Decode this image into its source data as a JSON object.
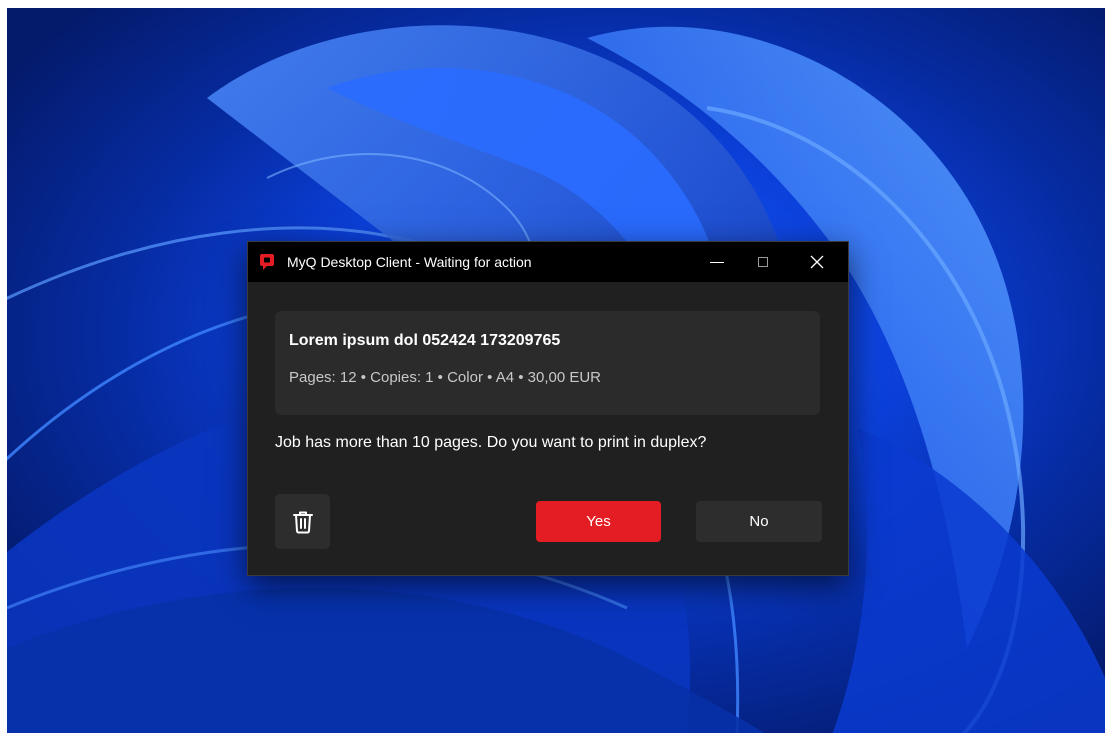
{
  "window": {
    "title": "MyQ Desktop Client - Waiting for action"
  },
  "job": {
    "name": "Lorem ipsum dol 052424 173209765",
    "details": "Pages: 12 • Copies: 1 • Color • A4 • 30,00 EUR"
  },
  "prompt": "Job has more than 10 pages. Do you want to print in duplex?",
  "buttons": {
    "yes": "Yes",
    "no": "No"
  },
  "icons": {
    "app": "myq-logo-icon",
    "delete": "trash-icon",
    "minimize": "minimize-icon",
    "maximize": "maximize-icon",
    "close": "close-icon"
  },
  "colors": {
    "accent": "#e31d23",
    "dialog_bg": "#202020",
    "titlebar_bg": "#000000",
    "card_bg": "#2b2b2b"
  }
}
